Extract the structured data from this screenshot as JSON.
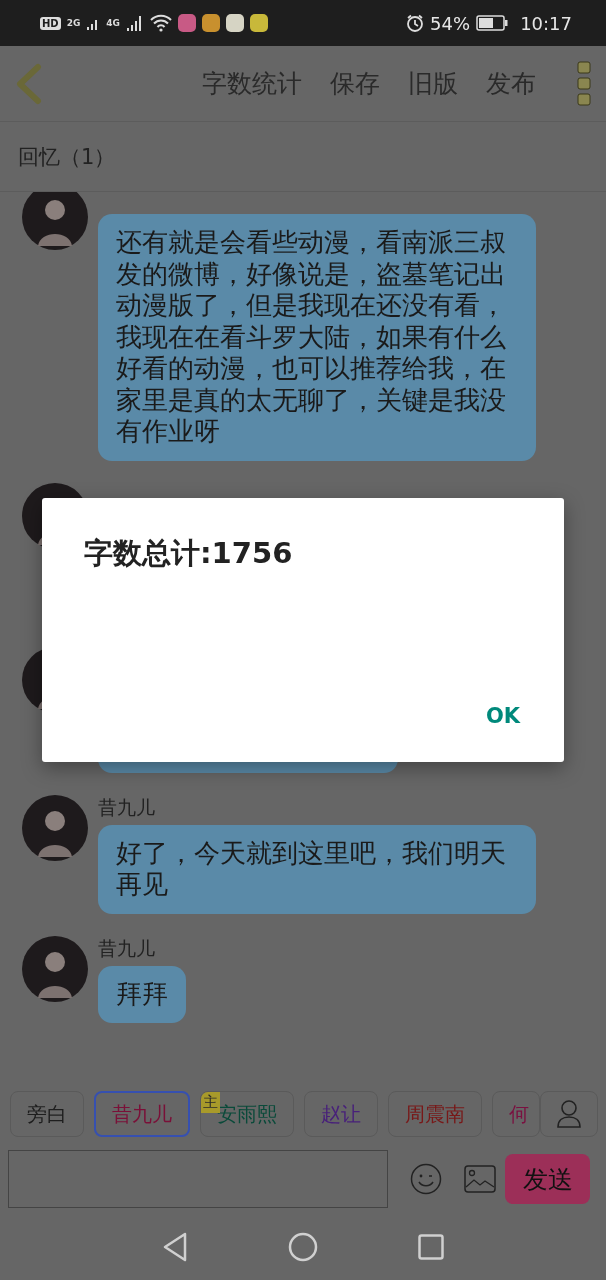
{
  "status_bar": {
    "left_labels": [
      "HD",
      "2G",
      "4G"
    ],
    "app_icons": [
      {
        "color": "#c85a85"
      },
      {
        "color": "#c8902e"
      },
      {
        "color": "#d6d4c4"
      },
      {
        "color": "#c8b83a"
      }
    ],
    "battery_text": "54%",
    "time": "10:17"
  },
  "header": {
    "actions": [
      "字数统计",
      "保存",
      "旧版",
      "发布"
    ]
  },
  "chapter_title": "回忆（1）",
  "messages": [
    {
      "kind": "message",
      "text": "还有就是会看些动漫，看南派三叔发的微博，好像说是，盗墓笔记出动漫版了，但是我现在还没有看，我现在在看斗罗大陆，如果有什么好看的动漫，也可以推荐给我，在家里是真的太无聊了，关键是我没有作业呀"
    },
    {
      "kind": "hidden"
    },
    {
      "kind": "covered"
    },
    {
      "kind": "message",
      "name": "昔九儿",
      "text": "好了，今天就到这里吧，我们明天再见"
    },
    {
      "kind": "message",
      "name": "昔九儿",
      "text": "拜拜"
    }
  ],
  "characters": [
    {
      "label": "旁白",
      "color": "#1e1e1e",
      "selected": false
    },
    {
      "label": "昔九儿",
      "color": "#7a1038",
      "selected": true
    },
    {
      "label": "安雨熙",
      "color": "#0a4a3a",
      "selected": false,
      "badge": "主"
    },
    {
      "label": "赵让",
      "color": "#48207a",
      "selected": false
    },
    {
      "label": "周震南",
      "color": "#781818",
      "selected": false
    },
    {
      "label": "何",
      "color": "#7a1040",
      "selected": false
    }
  ],
  "composer": {
    "send_label": "发送"
  },
  "dialog": {
    "title": "字数总计:1756",
    "ok_label": "OK"
  }
}
